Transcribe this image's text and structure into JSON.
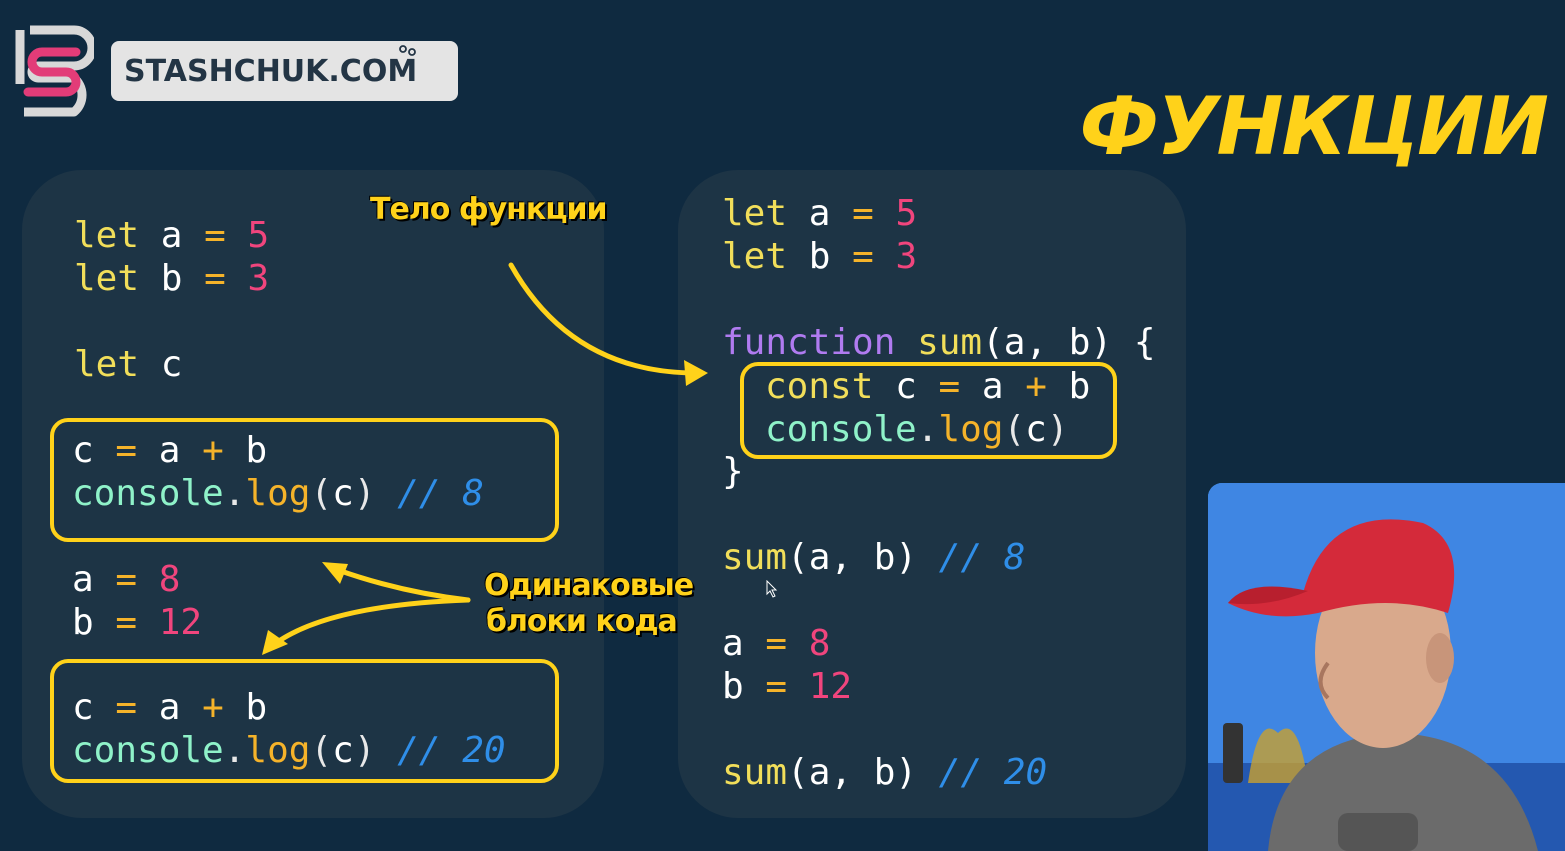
{
  "brand": {
    "site": "STASHCHUK.COM"
  },
  "title": "ФУНКЦИИ",
  "annotations": {
    "body_label": "Тело функции",
    "same_blocks_line1": "Одинаковые",
    "same_blocks_line2": "блоки кода"
  },
  "left_code": {
    "l1": {
      "kw": "let",
      "name": "a",
      "op": "=",
      "num": "5"
    },
    "l2": {
      "kw": "let",
      "name": "b",
      "op": "=",
      "num": "3"
    },
    "l3": {
      "kw": "let",
      "name": "c"
    },
    "block1": {
      "assign": {
        "target": "c",
        "eq": "=",
        "lhs": "a",
        "plus": "+",
        "rhs": "b"
      },
      "log": {
        "obj": "console",
        "dot": ".",
        "method": "log",
        "open": "(",
        "arg": "c",
        "close": ")",
        "comment": "// 8"
      }
    },
    "reassign": {
      "a": {
        "name": "a",
        "op": "=",
        "num": "8"
      },
      "b": {
        "name": "b",
        "op": "=",
        "num": "12"
      }
    },
    "block2": {
      "assign": {
        "target": "c",
        "eq": "=",
        "lhs": "a",
        "plus": "+",
        "rhs": "b"
      },
      "log": {
        "obj": "console",
        "dot": ".",
        "method": "log",
        "open": "(",
        "arg": "c",
        "close": ")",
        "comment": "// 20"
      }
    }
  },
  "right_code": {
    "l1": {
      "kw": "let",
      "name": "a",
      "op": "=",
      "num": "5"
    },
    "l2": {
      "kw": "let",
      "name": "b",
      "op": "=",
      "num": "3"
    },
    "fn": {
      "kw": "function",
      "name": "sum",
      "params": "(a, b)",
      "brace_open": "{",
      "brace_close": "}"
    },
    "body": {
      "const_kw": "const",
      "target": "c",
      "eq": "=",
      "lhs": "a",
      "plus": "+",
      "rhs": "b",
      "obj": "console",
      "dot": ".",
      "method": "log",
      "open": "(",
      "arg": "c",
      "close": ")"
    },
    "call1": {
      "name": "sum",
      "args": "(a, b)",
      "comment": "// 8"
    },
    "reassign": {
      "a": {
        "name": "a",
        "op": "=",
        "num": "8"
      },
      "b": {
        "name": "b",
        "op": "=",
        "num": "12"
      }
    },
    "call2": {
      "name": "sum",
      "args": "(a, b)",
      "comment": "// 20"
    }
  },
  "colors": {
    "background": "#0f2a40",
    "panel": "#1d3445",
    "highlight": "#ffd21a",
    "keyword": "#f1de5a",
    "number": "#f0457d",
    "comment": "#2f8ee8",
    "function_keyword": "#b07bf0",
    "console": "#8ff2c9"
  },
  "icons": [
    "stashchuk-logo-icon",
    "mouse-cursor-icon",
    "arrow-icon"
  ]
}
